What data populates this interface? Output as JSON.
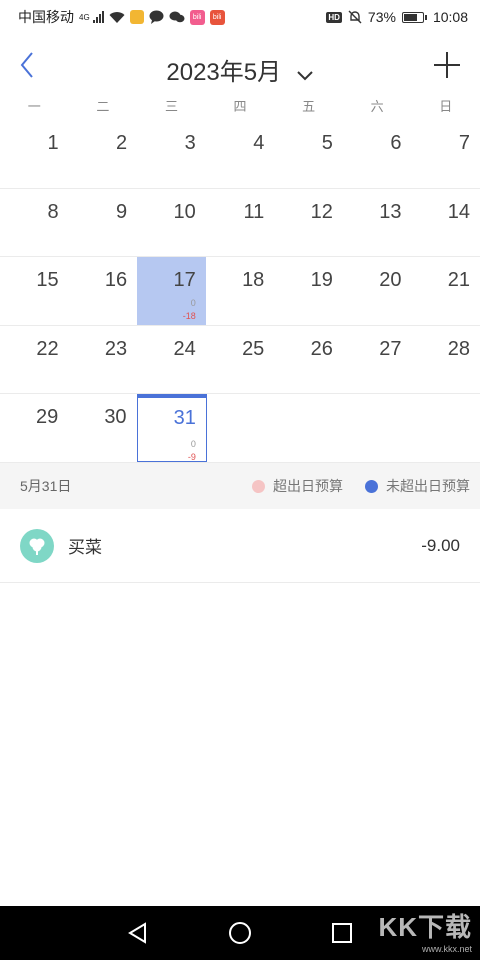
{
  "status_bar": {
    "carrier": "中国移动",
    "net": "4G",
    "app_chip_1": "bili",
    "app_chip_2": "bili",
    "hd": "HD",
    "battery": "73%",
    "battery_level": 0.73,
    "time": "10:08"
  },
  "header": {
    "title": "2023年5月",
    "accent": "#4a72d8"
  },
  "weekdays": [
    "一",
    "二",
    "三",
    "四",
    "五",
    "六",
    "日"
  ],
  "calendar": {
    "rows": [
      [
        {
          "day": "1"
        },
        {
          "day": "2"
        },
        {
          "day": "3"
        },
        {
          "day": "4"
        },
        {
          "day": "5"
        },
        {
          "day": "6"
        },
        {
          "day": "7"
        }
      ],
      [
        {
          "day": "8"
        },
        {
          "day": "9"
        },
        {
          "day": "10"
        },
        {
          "day": "11"
        },
        {
          "day": "12"
        },
        {
          "day": "13"
        },
        {
          "day": "14"
        }
      ],
      [
        {
          "day": "15"
        },
        {
          "day": "16"
        },
        {
          "day": "17",
          "income": "0",
          "expense": "-18",
          "state": "over"
        },
        {
          "day": "18"
        },
        {
          "day": "19"
        },
        {
          "day": "20"
        },
        {
          "day": "21"
        }
      ],
      [
        {
          "day": "22"
        },
        {
          "day": "23"
        },
        {
          "day": "24"
        },
        {
          "day": "25"
        },
        {
          "day": "26"
        },
        {
          "day": "27"
        },
        {
          "day": "28"
        }
      ],
      [
        {
          "day": "29"
        },
        {
          "day": "30"
        },
        {
          "day": "31",
          "income": "0",
          "expense": "-9",
          "state": "selected"
        },
        {},
        {},
        {},
        {}
      ]
    ]
  },
  "legend": {
    "date": "5月31日",
    "over_label": "超出日预算",
    "over_color": "#f5c4c4",
    "under_label": "未超出日预算",
    "under_color": "#4a72d8"
  },
  "records": [
    {
      "name": "买菜",
      "amount": "-9.00",
      "icon": "tree-icon",
      "icon_color": "#7fd7c6"
    }
  ],
  "watermark": {
    "big": "KK下载",
    "small": "www.kkx.net"
  }
}
